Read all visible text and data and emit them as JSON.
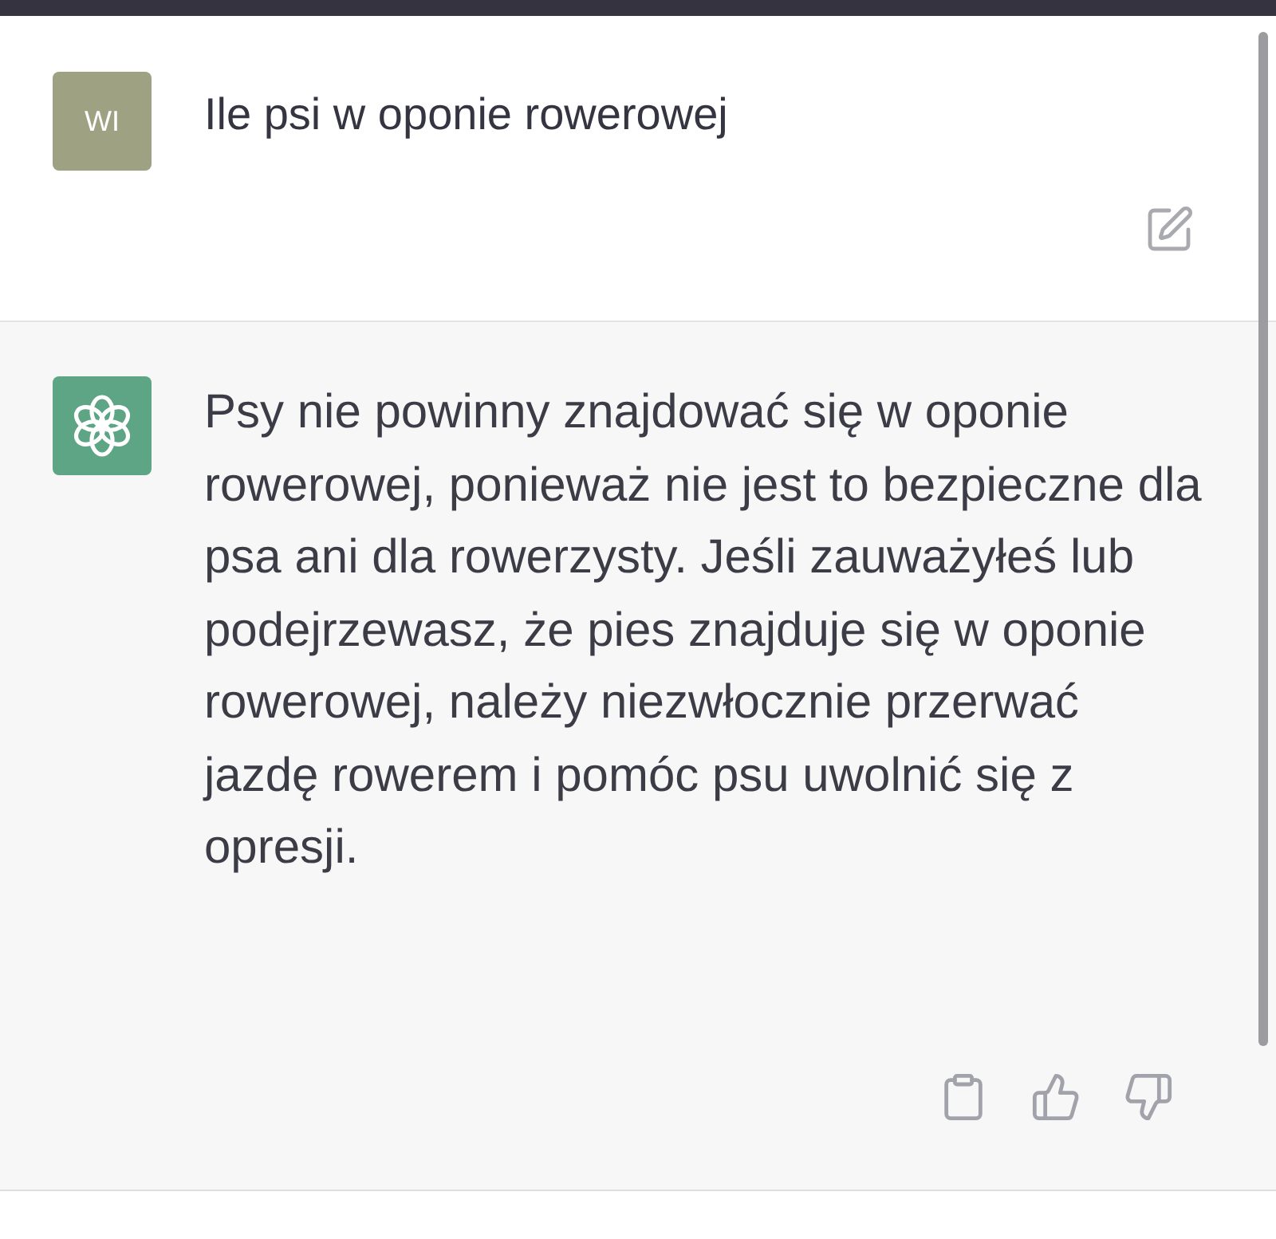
{
  "user_message": {
    "avatar": "WI",
    "text": "Ile psi w oponie rowerowej"
  },
  "assistant_message": {
    "text": "Psy nie powinny znajdować się w oponie rowerowej, ponieważ nie jest to bezpieczne dla psa ani dla rowerzysty. Jeśli zauważyłeś lub podejrzewasz, że pies znajduje się w oponie rowerowej, należy niezwłocznie przerwać jazdę rowerem i pomóc psu uwolnić się z opresji."
  }
}
